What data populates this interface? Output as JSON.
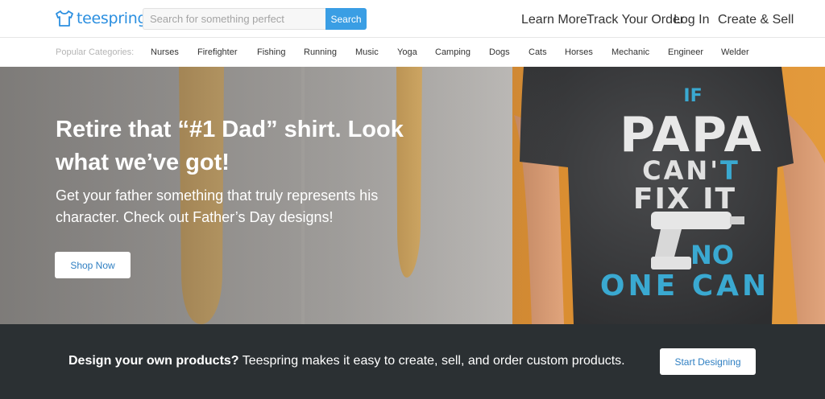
{
  "header": {
    "logo_text": "teespring",
    "search": {
      "placeholder": "Search for something perfect",
      "value": "",
      "button_label": "Search"
    },
    "nav": [
      "Learn More",
      "Track Your Order",
      "Log In",
      "Create & Sell"
    ]
  },
  "categories": {
    "label": "Popular Categories:",
    "items": [
      "Nurses",
      "Firefighter",
      "Fishing",
      "Running",
      "Music",
      "Yoga",
      "Camping",
      "Dogs",
      "Cats",
      "Horses",
      "Mechanic",
      "Engineer",
      "Welder"
    ]
  },
  "hero": {
    "title": "Retire that “#1 Dad” shirt. Look what we’ve got!",
    "subtitle": "Get your father something that truly represents his character. Check out Father’s Day designs!",
    "button_label": "Shop Now",
    "shirt_text": [
      "IF",
      "PAPA",
      "CAN'T",
      "FIX IT",
      "NO",
      "ONE CAN"
    ]
  },
  "design_strip": {
    "bold_text": "Design your own products?",
    "text": " Teespring makes it easy to create, sell, and order custom products.",
    "button_label": "Start Designing"
  },
  "colors": {
    "brand_blue": "#3a9ee4",
    "button_text_blue": "#2f7fc2",
    "dark_strip": "#2b3033",
    "shirt_accent": "#33a3c9"
  }
}
